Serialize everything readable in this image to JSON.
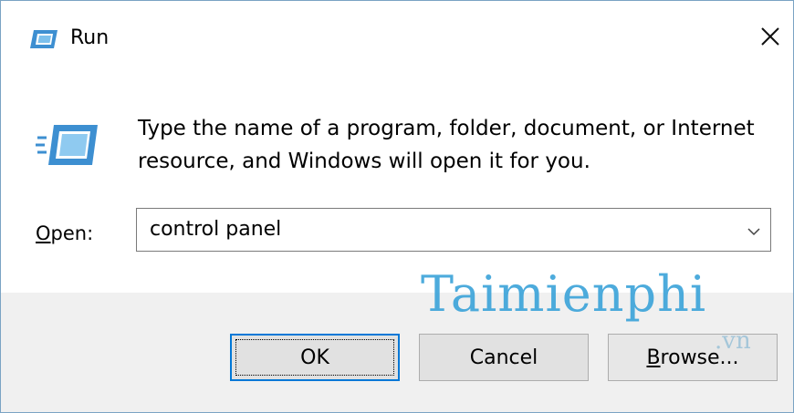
{
  "window": {
    "title": "Run",
    "title_icon": "run-icon",
    "close_icon": "close-icon"
  },
  "content": {
    "icon": "run-icon",
    "description": "Type the name of a program, folder, document, or Internet resource, and Windows will open it for you.",
    "open_label_accel": "O",
    "open_label_rest": "pen:",
    "input_value": "control panel",
    "dropdown_icon": "chevron-down-icon"
  },
  "buttons": {
    "ok": "OK",
    "cancel": "Cancel",
    "browse_accel": "B",
    "browse_rest": "rowse..."
  },
  "watermark": {
    "main": "Taimienphi",
    "suffix": ".vn"
  },
  "colors": {
    "accent": "#0078d7",
    "watermark": "#3aa3d9",
    "footer_bg": "#f0f0f0"
  }
}
